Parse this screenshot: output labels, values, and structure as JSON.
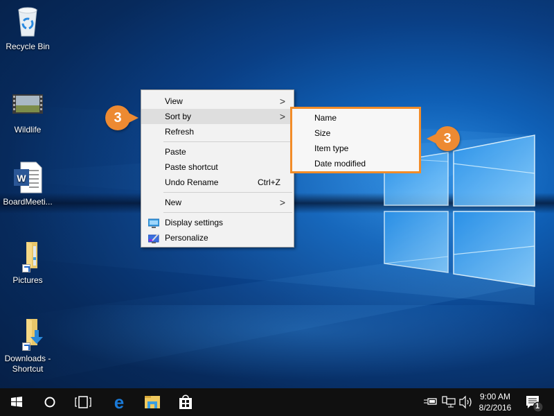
{
  "desktop": {
    "icons": [
      {
        "label": "Recycle Bin",
        "icon": "recycle-bin-icon"
      },
      {
        "label": "Wildlife",
        "icon": "video-icon"
      },
      {
        "label": "BoardMeeti...",
        "icon": "word-document-icon"
      },
      {
        "label": "Pictures",
        "icon": "folder-shortcut-icon"
      },
      {
        "label": "Downloads -\nShortcut",
        "icon": "downloads-shortcut-icon",
        "label_line1": "Downloads -",
        "label_line2": "Shortcut"
      }
    ]
  },
  "context_menu": {
    "items": [
      {
        "label": "View",
        "submenu": true
      },
      {
        "label": "Sort by",
        "submenu": true,
        "highlighted": true
      },
      {
        "label": "Refresh"
      },
      {
        "label": "Paste"
      },
      {
        "label": "Paste shortcut"
      },
      {
        "label": "Undo Rename",
        "shortcut": "Ctrl+Z"
      },
      {
        "label": "New",
        "submenu": true
      },
      {
        "label": "Display settings",
        "icon": "display-settings-icon"
      },
      {
        "label": "Personalize",
        "icon": "personalize-icon"
      }
    ],
    "arrow_glyph": ">"
  },
  "sort_submenu": {
    "items": [
      "Name",
      "Size",
      "Item type",
      "Date modified"
    ]
  },
  "callouts": [
    {
      "number": "3",
      "points_to": "Sort by"
    },
    {
      "number": "3",
      "points_to": "Sort submenu"
    }
  ],
  "colors": {
    "callout": "#ed8a32",
    "submenu_border": "#f28c28",
    "menu_hover": "#dedede",
    "taskbar": "#101010",
    "edge_blue": "#1a7ad8"
  },
  "taskbar": {
    "buttons": [
      "start-button",
      "cortana-button",
      "task-view-button",
      "edge-button",
      "file-explorer-button",
      "store-button"
    ],
    "tray": {
      "time": "9:00 AM",
      "date": "8/2/2016",
      "notifications_count": "1"
    }
  }
}
